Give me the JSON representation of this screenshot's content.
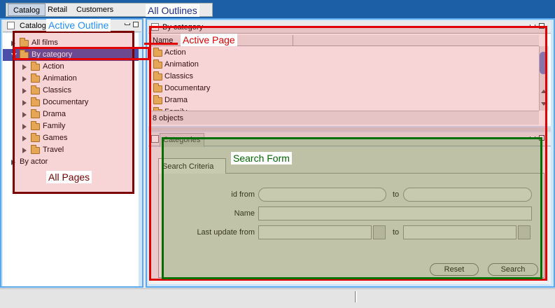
{
  "colors": {
    "all_outlines": "#1c2a8a",
    "active_outline": "#1e90ff",
    "active_page": "#e00000",
    "all_pages": "#7a0000",
    "search_form": "#006400",
    "selected_row": "#4c4fa8"
  },
  "top_tabs": [
    "Catalog",
    "Retail",
    "Customers"
  ],
  "left_pane": {
    "title": "Catalog"
  },
  "tree": [
    {
      "label": "All films",
      "level": 0,
      "folder": true,
      "arrow": "right"
    },
    {
      "label": "By category",
      "level": 0,
      "folder": true,
      "arrow": "down",
      "selected": true
    },
    {
      "label": "Action",
      "level": 1,
      "folder": true,
      "arrow": "right"
    },
    {
      "label": "Animation",
      "level": 1,
      "folder": true,
      "arrow": "right"
    },
    {
      "label": "Classics",
      "level": 1,
      "folder": true,
      "arrow": "right"
    },
    {
      "label": "Documentary",
      "level": 1,
      "folder": true,
      "arrow": "right"
    },
    {
      "label": "Drama",
      "level": 1,
      "folder": true,
      "arrow": "right"
    },
    {
      "label": "Family",
      "level": 1,
      "folder": true,
      "arrow": "right"
    },
    {
      "label": "Games",
      "level": 1,
      "folder": true,
      "arrow": "right"
    },
    {
      "label": "Travel",
      "level": 1,
      "folder": true,
      "arrow": "right"
    },
    {
      "label": "By actor",
      "level": 0,
      "folder": false,
      "arrow": "right"
    }
  ],
  "list_panel": {
    "title": "By category",
    "column_name": "Name",
    "rows": [
      "Action",
      "Animation",
      "Classics",
      "Documentary",
      "Drama",
      "Family"
    ],
    "status": "8 objects"
  },
  "categories_panel": {
    "tab": "Categories",
    "criteria_tab": "Search Criteria",
    "fields": {
      "id_from": "id from",
      "to": "to",
      "name": "Name",
      "last_update_from": "Last update from"
    },
    "buttons": {
      "reset": "Reset",
      "search": "Search"
    }
  },
  "annotations": {
    "all_outlines": "All Outlines",
    "active_outline": "Active Outline",
    "active_page": "Active Page",
    "all_pages": "All Pages",
    "search_form": "Search Form"
  }
}
